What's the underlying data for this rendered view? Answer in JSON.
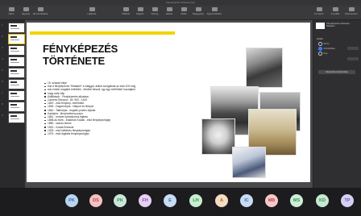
{
  "window": {
    "title": "Fényképezés története.key",
    "traffic_lights": [
      "#fe5f57",
      "#febc2e",
      "#28c840"
    ]
  },
  "toolbar": {
    "buttons": [
      {
        "label": "Nézet"
      },
      {
        "label": "Nagyítás"
      },
      {
        "label": "Dia hozzáadása"
      },
      {
        "label": "Lejátszás"
      },
      {
        "label": "Táblázat"
      },
      {
        "label": "Diagram"
      },
      {
        "label": "Szöveg"
      },
      {
        "label": "Alakzat"
      },
      {
        "label": "Média"
      },
      {
        "label": "Megjegyzés"
      },
      {
        "label": "Együttműködés"
      },
      {
        "label": "Formátum"
      },
      {
        "label": "Animálás"
      },
      {
        "label": "Dokumentum"
      }
    ]
  },
  "navigator": {
    "slide_numbers": [
      "1",
      "2",
      "3",
      "4",
      "5",
      "6",
      "7",
      "8",
      "9"
    ]
  },
  "slide": {
    "title_line1": "FÉNYKÉPEZÉS",
    "title_line2": "TÖRTÉNETE",
    "bullets": [
      "15. század eleje",
      "Hat a fényképezés \"feltalálói\" a világgal, akiket szolgálnak az első 100 évig",
      "sok ember magától értetődik - felvétel készül, így egy mérföldkő hozzájárul",
      "hogy szép kép",
      "Kiállítások - Fényképezés alkotása",
      "Camera Obscura - kb. 900 - 1400",
      "1820 - első fénykép, mérföldkő",
      "1836 - Dagerrotípia - Niépce és Nièpce",
      "1840 - Talbotípia - negatív-pozitív eljárás",
      "Kalotípia - fényérzékeny papír",
      "1851 - nedves kollódiumos eljárás",
      "1858-as évek - Eastman Kodak - első fényképezőgép",
      "1880 - száraz lemez",
      "1900 - Kodak Brownie",
      "1925 - első kisfilmes fényképezőgép",
      "1975 - első digitális fényképezőgép"
    ]
  },
  "inspector": {
    "slide_label": "Fényképezés története - Diagram",
    "section": "Háttér",
    "options": [
      "Nincs",
      "Színkitöltés",
      "Kép"
    ],
    "selected_option": "Színkitöltés",
    "button": "Mesterdia szerkesztése"
  },
  "participants": [
    {
      "initials": "PK",
      "color": "#b9d4f0"
    },
    {
      "initials": "DS",
      "color": "#f4c2c2"
    },
    {
      "initials": "PK",
      "color": "#c9e9d8"
    },
    {
      "initials": "FH",
      "color": "#e5d1f2"
    },
    {
      "initials": "E",
      "color": "#c9dcf5"
    },
    {
      "initials": "LH",
      "color": "#c7edd0"
    },
    {
      "initials": "A",
      "color": "#f5dcc3"
    },
    {
      "initials": "IC",
      "color": "#c9dcf5"
    },
    {
      "initials": "MB",
      "color": "#f6c9c9"
    },
    {
      "initials": "MS",
      "color": "#cdeed6"
    },
    {
      "initials": "KD",
      "color": "#c7e9d2"
    },
    {
      "initials": "TP",
      "color": "#d6cef3"
    }
  ]
}
